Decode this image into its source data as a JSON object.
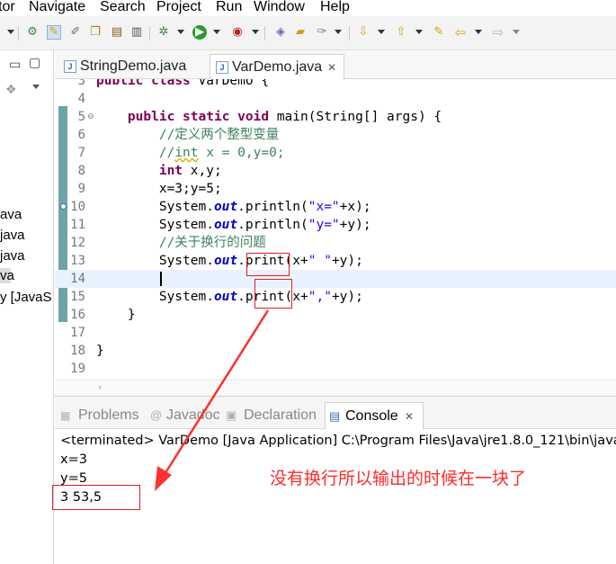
{
  "menu": [
    "tor",
    "Navigate",
    "Search",
    "Project",
    "Run",
    "Window",
    "Help"
  ],
  "toolbar_icons": [
    "debug-perspective-icon",
    "edit-icon",
    "pin-icon",
    "copy-icon",
    "notes-icon",
    "panel-icon",
    "bug-icon",
    "run-icon",
    "stop-icon",
    "package-icon",
    "open-folder-icon",
    "brush-icon",
    "next-annotation-icon",
    "prev-annotation-icon",
    "last-edit-icon",
    "back-icon",
    "forward-icon"
  ],
  "left_panel": {
    "items": [
      "ava",
      "java",
      "java",
      "va",
      "y [JavaS"
    ]
  },
  "editor": {
    "tabs": [
      {
        "label": "StringDemo.java",
        "active": false
      },
      {
        "label": "VarDemo.java",
        "active": true
      }
    ],
    "close_glyph": "✕",
    "lines": [
      {
        "num": "3",
        "text": "public class VarDemo {"
      },
      {
        "num": "4",
        "text": ""
      },
      {
        "num": "5",
        "text": "    public static void main(String[] args) {"
      },
      {
        "num": "6",
        "text": "        //定义两个整型变量"
      },
      {
        "num": "7",
        "text": "        //int x = 0,y=0;"
      },
      {
        "num": "8",
        "text": "        int x,y;"
      },
      {
        "num": "9",
        "text": "        x=3;y=5;"
      },
      {
        "num": "10",
        "text": "        System.out.println(\"x=\"+x);"
      },
      {
        "num": "11",
        "text": "        System.out.println(\"y=\"+y);"
      },
      {
        "num": "12",
        "text": "        //关于换行的问题"
      },
      {
        "num": "13",
        "text": "        System.out.print(x+\" \"+y);"
      },
      {
        "num": "14",
        "text": ""
      },
      {
        "num": "15",
        "text": "        System.out.print(x+\",\"+y);"
      },
      {
        "num": "16",
        "text": "    }"
      },
      {
        "num": "17",
        "text": ""
      },
      {
        "num": "18",
        "text": "}"
      },
      {
        "num": "19",
        "text": ""
      }
    ]
  },
  "console": {
    "tabs": [
      {
        "label": "Problems",
        "active": false
      },
      {
        "label": "Javadoc",
        "active": false
      },
      {
        "label": "Declaration",
        "active": false
      },
      {
        "label": "Console",
        "active": true
      }
    ],
    "header": "<terminated> VarDemo [Java Application] C:\\Program Files\\Java\\jre1.8.0_121\\bin\\java",
    "output": [
      "x=3",
      "y=5",
      "3 53,5"
    ]
  },
  "annotation": "没有换行所以输出的时候在一块了",
  "colors": {
    "keyword": "#7f0055",
    "comment": "#3f7f5f",
    "string": "#2a00ff",
    "field": "#0000c0",
    "annotation": "#ff2a2a"
  }
}
